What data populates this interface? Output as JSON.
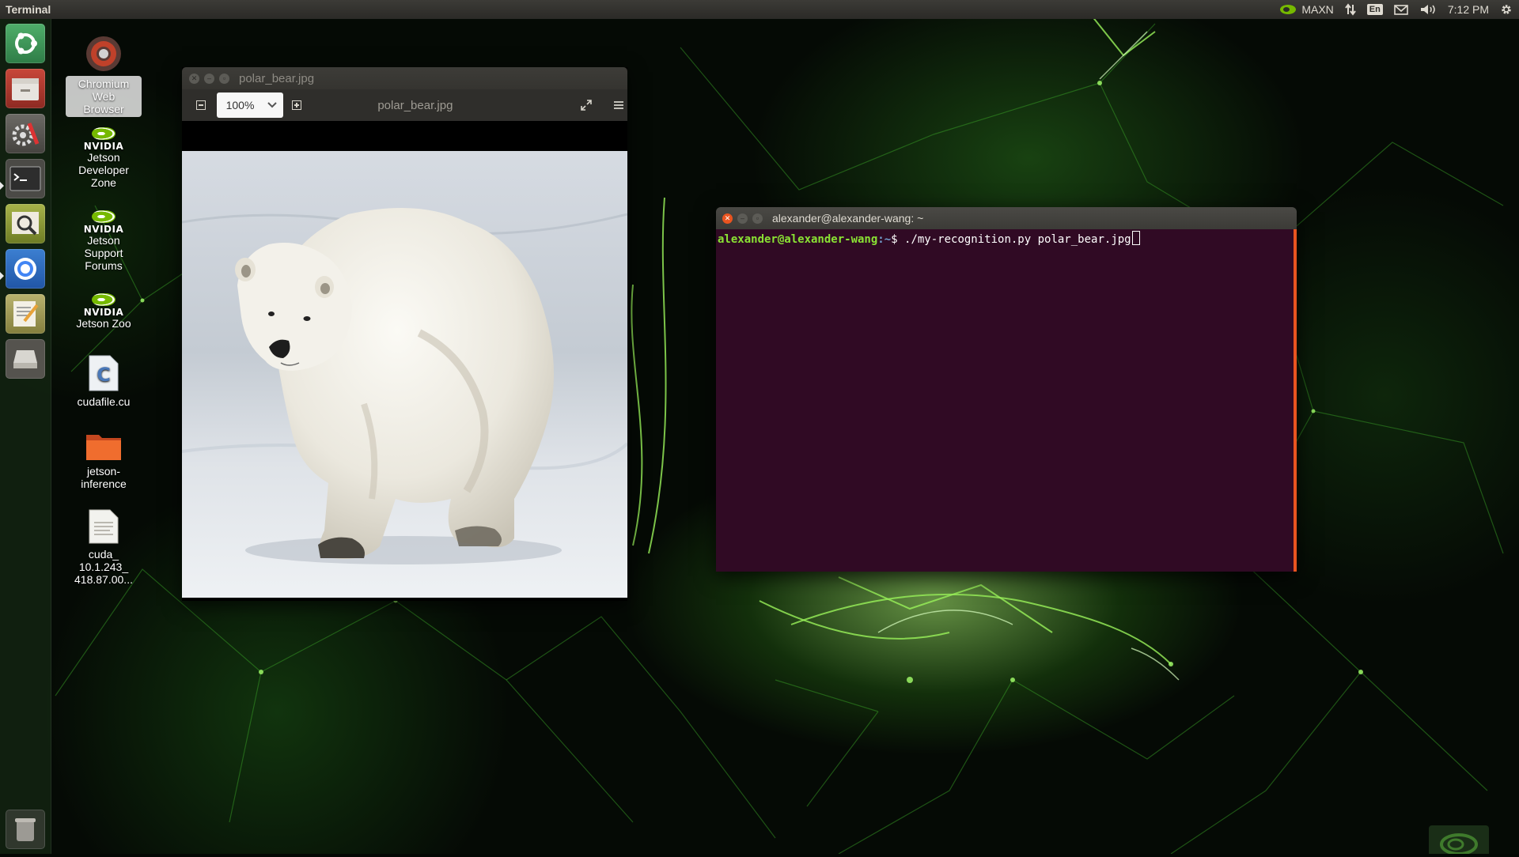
{
  "panel": {
    "app_title": "Terminal",
    "power_mode": "MAXN",
    "keyboard_layout": "En",
    "clock": "7:12 PM"
  },
  "launcher": {
    "items": [
      {
        "icon": "ubuntu-dash-icon"
      },
      {
        "icon": "files-icon"
      },
      {
        "icon": "system-settings-icon"
      },
      {
        "icon": "terminal-icon",
        "running": true
      },
      {
        "icon": "image-viewer-icon"
      },
      {
        "icon": "chromium-icon",
        "running": true
      },
      {
        "icon": "text-editor-icon"
      },
      {
        "icon": "drive-icon"
      },
      {
        "icon": "trash-icon"
      }
    ]
  },
  "desktop": {
    "icons": [
      {
        "label": "Chromium Web Browser",
        "lines": [
          "Chromium",
          "Web",
          "Browser"
        ],
        "icon": "chromium-icon"
      },
      {
        "lines": [
          "Jetson",
          "Developer",
          "Zone"
        ],
        "icon": "nvidia-logo-icon"
      },
      {
        "lines": [
          "Jetson",
          "Support",
          "Forums"
        ],
        "icon": "nvidia-logo-icon"
      },
      {
        "lines": [
          "Jetson Zoo"
        ],
        "icon": "nvidia-logo-icon"
      },
      {
        "lines": [
          "cudafile.cu"
        ],
        "icon": "c-source-file-icon"
      },
      {
        "lines": [
          "jetson-",
          "inference"
        ],
        "icon": "folder-icon"
      },
      {
        "lines": [
          "cuda_",
          "10.1.243_",
          "418.87.00..."
        ],
        "icon": "document-file-icon"
      }
    ],
    "nvidia_wordmark": "NVIDIA"
  },
  "viewer": {
    "window_title": "polar_bear.jpg",
    "toolbar_title": "polar_bear.jpg",
    "zoom": "100%"
  },
  "terminal": {
    "window_title": "alexander@alexander-wang: ~",
    "prompt_user": "alexander@alexander-wang",
    "prompt_path": ":~",
    "prompt_symbol": "$",
    "command": " ./my-recognition.py polar_bear.jpg"
  },
  "colors": {
    "accent": "#e95420",
    "terminal_bg": "#300a24",
    "prompt_green": "#8ae234",
    "nvidia_green": "#76b900"
  }
}
